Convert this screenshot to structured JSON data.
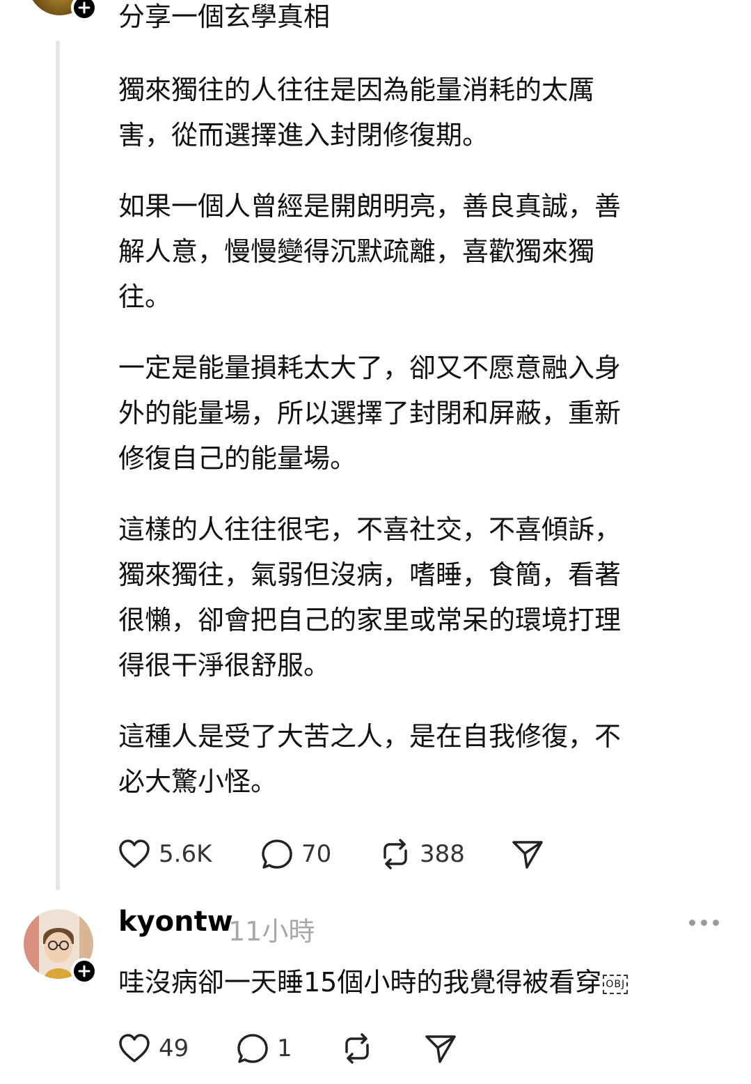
{
  "post": {
    "title": "分享一個玄學真相",
    "paragraphs": [
      [
        "獨來獨往的人往往是因為能量消耗的太厲",
        "害，從而選擇進入封閉修復期。"
      ],
      [
        "如果一個人曾經是開朗明亮，善良真誠，善",
        "解人意，慢慢變得沉默疏離，喜歡獨來獨",
        "往。"
      ],
      [
        "一定是能量損耗太大了，卻又不愿意融入身",
        "外的能量場，所以選擇了封閉和屏蔽，重新",
        "修復自己的能量場。"
      ],
      [
        "這樣的人往往很宅，不喜社交，不喜傾訴，",
        "獨來獨往，氣弱但沒病，嗜睡，食簡，看著",
        "很懶，卻會把自己的家里或常呆的環境打理",
        "得很干淨很舒服。"
      ],
      [
        "這種人是受了大苦之人，是在自我修復，不",
        "必大驚小怪。"
      ]
    ],
    "actions": {
      "likes": "5.6K",
      "comments": "70",
      "reposts": "388"
    }
  },
  "reply": {
    "username": "kyontw",
    "time": "11小時",
    "text": "哇沒病卻一天睡15個小時的我覺得被看穿",
    "obj_label": "OBJ",
    "actions": {
      "likes": "49",
      "comments": "1"
    }
  },
  "icons": {
    "like": "heart-icon",
    "comment": "comment-bubble-icon",
    "repost": "repost-icon",
    "share": "send-icon",
    "follow": "plus-icon",
    "more": "more-dots-icon"
  }
}
